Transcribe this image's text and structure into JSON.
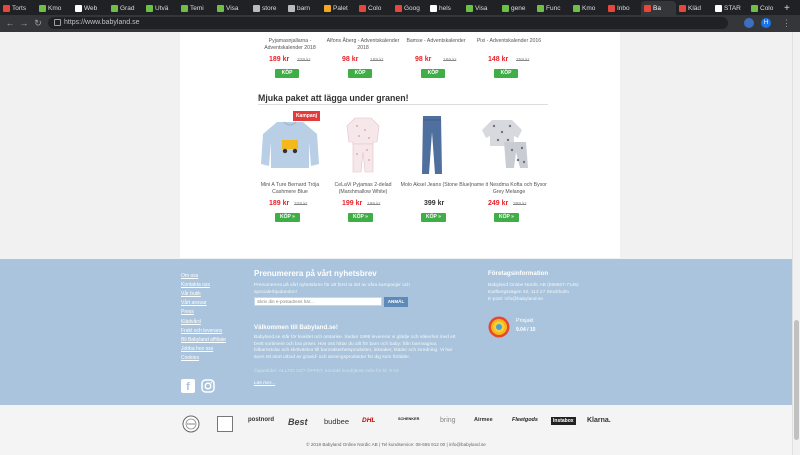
{
  "browser": {
    "tabs": [
      {
        "label": "Torts",
        "color": "#e8453c"
      },
      {
        "label": "Kmo",
        "color": "#6fbf47"
      },
      {
        "label": "Web",
        "color": "#ffffff"
      },
      {
        "label": "Grad",
        "color": "#6fbf47"
      },
      {
        "label": "Utvä",
        "color": "#6fbf47"
      },
      {
        "label": "Temi",
        "color": "#6fbf47"
      },
      {
        "label": "Visa",
        "color": "#6fbf47"
      },
      {
        "label": "store",
        "color": "#bbbbbb"
      },
      {
        "label": "barn",
        "color": "#bbbbbb"
      },
      {
        "label": "Palet",
        "color": "#f5a623"
      },
      {
        "label": "Colo",
        "color": "#e8453c"
      },
      {
        "label": "Goog",
        "color": "#e8453c"
      },
      {
        "label": "hels",
        "color": "#ffffff"
      },
      {
        "label": "Visa",
        "color": "#6fbf47"
      },
      {
        "label": "gene",
        "color": "#6fbf47"
      },
      {
        "label": "Func",
        "color": "#6fbf47"
      },
      {
        "label": "Kmo",
        "color": "#6fbf47"
      },
      {
        "label": "Inbo",
        "color": "#e8453c"
      },
      {
        "label": "Ba",
        "color": "#e8453c",
        "active": true
      },
      {
        "label": "Kläd",
        "color": "#e8453c"
      },
      {
        "label": "STAR",
        "color": "#ffffff"
      },
      {
        "label": "Colo",
        "color": "#6fbf47"
      }
    ],
    "new_tab": "+",
    "url": "https://www.babyland.se",
    "ext_avatar": "H"
  },
  "top_products": [
    {
      "name": "Pyjamasnjallarna - Adventskalender 2018",
      "price": "189 kr",
      "old": "329 kr",
      "buy": "KÖP"
    },
    {
      "name": "Alfons Åberg - Adventskalender 2018",
      "price": "98 kr",
      "old": "189 kr",
      "buy": "KÖP"
    },
    {
      "name": "Bamse - Adventskalender",
      "price": "98 kr",
      "old": "189 kr",
      "buy": "KÖP"
    },
    {
      "name": "Pixi - Adventskalender 2016",
      "price": "148 kr",
      "old": "259 kr",
      "buy": "KÖP"
    }
  ],
  "section_title": "Mjuka paket att lägga under granen!",
  "campaign_badge": "Kampanj",
  "products": [
    {
      "name": "Mini A Ture Bernard Tröja Cashmere Blue",
      "price": "189 kr",
      "old": "329 kr",
      "buy": "KÖP »"
    },
    {
      "name": "CeLaVi Pyjamas 2-delad (Marshmallow White)",
      "price": "199 kr",
      "old": "199 kr",
      "buy": "KÖP »"
    },
    {
      "name": "Molo Aksel Jeans (Stone Blue)",
      "price": "399 kr",
      "old": "",
      "buy": "KÖP »"
    },
    {
      "name": "name it Nesdma Kofta och Byxor Grey Melange",
      "price": "249 kr",
      "old": "399 kr",
      "buy": "KÖP »"
    }
  ],
  "footer": {
    "links": [
      "Om oss",
      "Kontakta oss",
      "Vår butik",
      "Vårt ansvar",
      "Press",
      "Klädvård",
      "Frakt och leverans",
      "Bli Babyland affiliate",
      "Jobba hos oss",
      "Cookies"
    ],
    "newsletter_title": "Prenumerera på vårt nyhetsbrev",
    "newsletter_text": "Prenumerera på vårt nyhetsbrev för att först ta del av våra kampanjer och specialerbjudanden!",
    "newsletter_placeholder": "Skriv din e-postadress här...",
    "newsletter_button": "ANMÄL",
    "welcome_title": "Välkommen till Babyland.se!",
    "welcome_text": "Babyland.se står för kvalitet och omtanke. Sedan 1999 levererar vi glädje och säkerhet med ett brett sortiment och bra priser. Hos oss hittar du allt för barn och baby: från barnvagnar, bilbarnstolar och skötväskor till barnsäkerhetsprodukter, leksaker, kläder och inredning. Vi har även ett stort utbud av gravid- och amningsprodukter för dig som förälder.",
    "welcome_faded": "Öppettider: ALLTID 24/7 ÖPPET, kontakt kundtjänst mån-fre kl. 9-16",
    "read_more": "Läs mer...",
    "company_title": "Företagsinformation",
    "company_lines": [
      "Babyland Online Nordic AB (556607-7145)",
      "Karlbergsvägen 40, 113 27 Stockholm",
      "E-post: info@babyland.se"
    ],
    "prisjakt_label": "Prisjakt",
    "prisjakt_score": "9.04 / 10"
  },
  "logos": [
    "postnord",
    "Best",
    "budbee",
    "DHL",
    "SCHENKER",
    "bring",
    "Airmee",
    "Fleetgods",
    "Instabox",
    "Klarna."
  ],
  "copyright": "© 2018 Babyland Online Nordic AB  |  Tel kundservice: 08-555 912 00  |  info@babyland.se",
  "colors": {
    "accent_green": "#3fae46",
    "price_red": "#e8222a",
    "footer_blue": "#a9c4dc"
  }
}
